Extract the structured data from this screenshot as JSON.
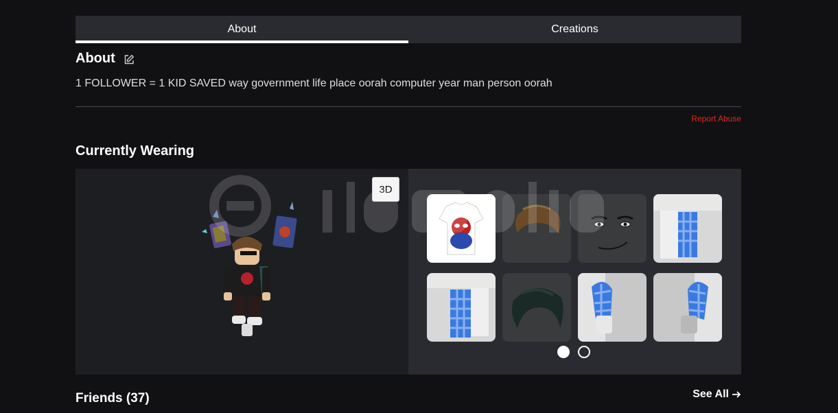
{
  "tabs": [
    {
      "label": "About",
      "active": true
    },
    {
      "label": "Creations",
      "active": false
    }
  ],
  "about": {
    "title": "About",
    "edit_icon": "edit-icon",
    "description": "1 FOLLOWER = 1 KID SAVED way government life place oorah computer year man person oorah",
    "report_label": "Report Abuse"
  },
  "wearing": {
    "title": "Currently Wearing",
    "view_toggle_label": "3D",
    "items": [
      {
        "name": "spiderman-tshirt"
      },
      {
        "name": "brown-hair"
      },
      {
        "name": "man-face"
      },
      {
        "name": "blue-checkered-right-leg"
      },
      {
        "name": "blue-checkered-left-leg"
      },
      {
        "name": "dark-green-hair"
      },
      {
        "name": "blue-checkered-left-arm"
      },
      {
        "name": "blue-checkered-right-arm"
      }
    ],
    "pages": 2,
    "current_page": 1
  },
  "friends": {
    "title": "Friends (37)",
    "see_all_label": "See All"
  },
  "colors": {
    "background": "#111114",
    "tab_bar": "#2a2b30",
    "report": "#e0291d",
    "tile": "#393b3d"
  }
}
